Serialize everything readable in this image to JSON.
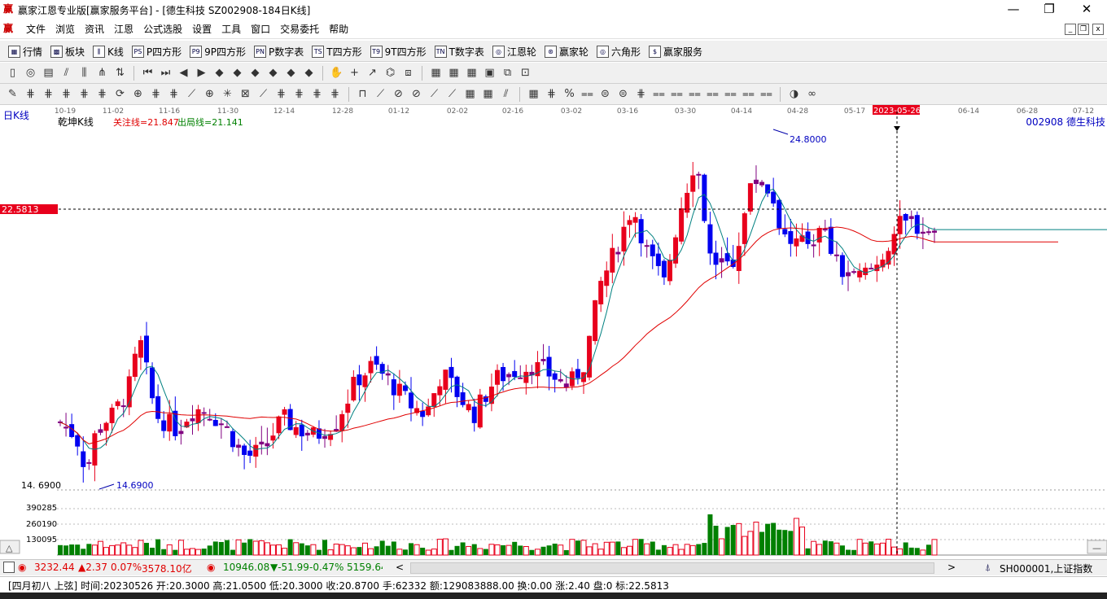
{
  "window": {
    "title": "赢家江恩专业版[赢家服务平台] - [德生科技   SZ002908-184日K线]",
    "app_icon": "赢",
    "controls": [
      "—",
      "❐",
      "✕"
    ]
  },
  "menu": {
    "items": [
      "文件",
      "浏览",
      "资讯",
      "江恩",
      "公式选股",
      "设置",
      "工具",
      "窗口",
      "交易委托",
      "帮助"
    ],
    "mdi_controls": [
      "_",
      "❐",
      "x"
    ]
  },
  "toolbar1": [
    {
      "icon": "quote-table-icon",
      "glyph": "▦",
      "label": "行情"
    },
    {
      "icon": "sector-icon",
      "glyph": "▩",
      "label": "板块"
    },
    {
      "icon": "kline-icon",
      "glyph": "⫼",
      "label": "K线"
    },
    {
      "icon": "p-square-icon",
      "glyph": "PS",
      "label": "P四方形"
    },
    {
      "icon": "9p-square-icon",
      "glyph": "P9",
      "label": "9P四方形"
    },
    {
      "icon": "p-number-table-icon",
      "glyph": "PN",
      "label": "P数字表"
    },
    {
      "icon": "t-square-icon",
      "glyph": "TS",
      "label": "T四方形"
    },
    {
      "icon": "9t-square-icon",
      "glyph": "T9",
      "label": "9T四方形"
    },
    {
      "icon": "t-number-table-icon",
      "glyph": "TN",
      "label": "T数字表"
    },
    {
      "icon": "gann-wheel-icon",
      "glyph": "◎",
      "label": "江恩轮"
    },
    {
      "icon": "winner-wheel-icon",
      "glyph": "⊛",
      "label": "赢家轮"
    },
    {
      "icon": "hexagon-icon",
      "glyph": "◎",
      "label": "六角形"
    },
    {
      "icon": "service-icon",
      "glyph": "$",
      "label": "赢家服务"
    }
  ],
  "chart": {
    "period_label": "日K线",
    "indicator_name": "乾坤K线",
    "focus_line": "关注线=21.847",
    "exit_line": "出局线=21.141",
    "stock": "002908  德生科技",
    "current_price_tag": "22.5813",
    "low_label": "14.6900",
    "low_axis_label": "14. 6900",
    "high_label": "24.8000",
    "cursor_date": "2023-05-26",
    "date_ticks": [
      "10-19",
      "11-02",
      "11-16",
      "11-30",
      "12-14",
      "12-28",
      "01-12",
      "02-02",
      "02-16",
      "03-02",
      "03-16",
      "03-30",
      "04-14",
      "04-28",
      "05-17",
      "2023-05-26",
      "06-14",
      "06-28",
      "07-12"
    ],
    "volume_axis": [
      "390285",
      "260190",
      "130095"
    ]
  },
  "status1": {
    "sh_index": "3232.44",
    "sh_change": "▲2.37",
    "sh_pct": "0.07%",
    "sh_amount": "3578.10亿",
    "sz_index": "10946.08",
    "sz_change": "▼-51.99",
    "sz_pct": "-0.47%",
    "sz_amount": "5159.64",
    "right_label": "SH000001,上证指数"
  },
  "status2": {
    "text": "[四月初八  上弦] 时间:20230526 开:20.3000 高:21.0500 低:20.3000 收:20.8700 手:62332 额:129083888.00 换:0.00 涨:2.40 盘:0 标:22.5813"
  },
  "colors": {
    "up": "#e8001c",
    "down": "#0000f0",
    "flat": "#800080",
    "ma_short": "#008080",
    "ma_long": "#e00000",
    "volume": "#008000"
  },
  "chart_data": {
    "type": "candlestick",
    "ylim": [
      14.69,
      24.8
    ],
    "volume_ticks": [
      130095,
      260190,
      390285
    ],
    "highlight": {
      "date": "2023-05-26",
      "open": 20.3,
      "high": 21.05,
      "low": 20.3,
      "close": 20.87,
      "volume": 62332
    }
  }
}
